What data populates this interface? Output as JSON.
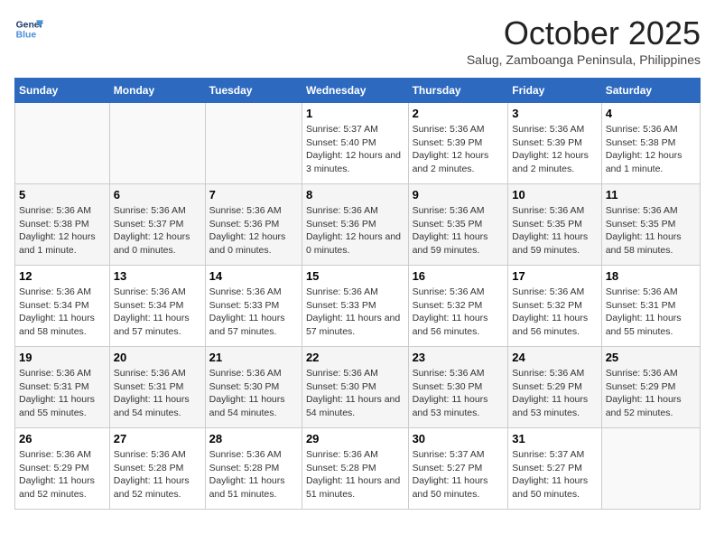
{
  "header": {
    "logo_line1": "General",
    "logo_line2": "Blue",
    "month": "October 2025",
    "location": "Salug, Zamboanga Peninsula, Philippines"
  },
  "weekdays": [
    "Sunday",
    "Monday",
    "Tuesday",
    "Wednesday",
    "Thursday",
    "Friday",
    "Saturday"
  ],
  "weeks": [
    [
      {
        "day": "",
        "info": ""
      },
      {
        "day": "",
        "info": ""
      },
      {
        "day": "",
        "info": ""
      },
      {
        "day": "1",
        "info": "Sunrise: 5:37 AM\nSunset: 5:40 PM\nDaylight: 12 hours and 3 minutes."
      },
      {
        "day": "2",
        "info": "Sunrise: 5:36 AM\nSunset: 5:39 PM\nDaylight: 12 hours and 2 minutes."
      },
      {
        "day": "3",
        "info": "Sunrise: 5:36 AM\nSunset: 5:39 PM\nDaylight: 12 hours and 2 minutes."
      },
      {
        "day": "4",
        "info": "Sunrise: 5:36 AM\nSunset: 5:38 PM\nDaylight: 12 hours and 1 minute."
      }
    ],
    [
      {
        "day": "5",
        "info": "Sunrise: 5:36 AM\nSunset: 5:38 PM\nDaylight: 12 hours and 1 minute."
      },
      {
        "day": "6",
        "info": "Sunrise: 5:36 AM\nSunset: 5:37 PM\nDaylight: 12 hours and 0 minutes."
      },
      {
        "day": "7",
        "info": "Sunrise: 5:36 AM\nSunset: 5:36 PM\nDaylight: 12 hours and 0 minutes."
      },
      {
        "day": "8",
        "info": "Sunrise: 5:36 AM\nSunset: 5:36 PM\nDaylight: 12 hours and 0 minutes."
      },
      {
        "day": "9",
        "info": "Sunrise: 5:36 AM\nSunset: 5:35 PM\nDaylight: 11 hours and 59 minutes."
      },
      {
        "day": "10",
        "info": "Sunrise: 5:36 AM\nSunset: 5:35 PM\nDaylight: 11 hours and 59 minutes."
      },
      {
        "day": "11",
        "info": "Sunrise: 5:36 AM\nSunset: 5:35 PM\nDaylight: 11 hours and 58 minutes."
      }
    ],
    [
      {
        "day": "12",
        "info": "Sunrise: 5:36 AM\nSunset: 5:34 PM\nDaylight: 11 hours and 58 minutes."
      },
      {
        "day": "13",
        "info": "Sunrise: 5:36 AM\nSunset: 5:34 PM\nDaylight: 11 hours and 57 minutes."
      },
      {
        "day": "14",
        "info": "Sunrise: 5:36 AM\nSunset: 5:33 PM\nDaylight: 11 hours and 57 minutes."
      },
      {
        "day": "15",
        "info": "Sunrise: 5:36 AM\nSunset: 5:33 PM\nDaylight: 11 hours and 57 minutes."
      },
      {
        "day": "16",
        "info": "Sunrise: 5:36 AM\nSunset: 5:32 PM\nDaylight: 11 hours and 56 minutes."
      },
      {
        "day": "17",
        "info": "Sunrise: 5:36 AM\nSunset: 5:32 PM\nDaylight: 11 hours and 56 minutes."
      },
      {
        "day": "18",
        "info": "Sunrise: 5:36 AM\nSunset: 5:31 PM\nDaylight: 11 hours and 55 minutes."
      }
    ],
    [
      {
        "day": "19",
        "info": "Sunrise: 5:36 AM\nSunset: 5:31 PM\nDaylight: 11 hours and 55 minutes."
      },
      {
        "day": "20",
        "info": "Sunrise: 5:36 AM\nSunset: 5:31 PM\nDaylight: 11 hours and 54 minutes."
      },
      {
        "day": "21",
        "info": "Sunrise: 5:36 AM\nSunset: 5:30 PM\nDaylight: 11 hours and 54 minutes."
      },
      {
        "day": "22",
        "info": "Sunrise: 5:36 AM\nSunset: 5:30 PM\nDaylight: 11 hours and 54 minutes."
      },
      {
        "day": "23",
        "info": "Sunrise: 5:36 AM\nSunset: 5:30 PM\nDaylight: 11 hours and 53 minutes."
      },
      {
        "day": "24",
        "info": "Sunrise: 5:36 AM\nSunset: 5:29 PM\nDaylight: 11 hours and 53 minutes."
      },
      {
        "day": "25",
        "info": "Sunrise: 5:36 AM\nSunset: 5:29 PM\nDaylight: 11 hours and 52 minutes."
      }
    ],
    [
      {
        "day": "26",
        "info": "Sunrise: 5:36 AM\nSunset: 5:29 PM\nDaylight: 11 hours and 52 minutes."
      },
      {
        "day": "27",
        "info": "Sunrise: 5:36 AM\nSunset: 5:28 PM\nDaylight: 11 hours and 52 minutes."
      },
      {
        "day": "28",
        "info": "Sunrise: 5:36 AM\nSunset: 5:28 PM\nDaylight: 11 hours and 51 minutes."
      },
      {
        "day": "29",
        "info": "Sunrise: 5:36 AM\nSunset: 5:28 PM\nDaylight: 11 hours and 51 minutes."
      },
      {
        "day": "30",
        "info": "Sunrise: 5:37 AM\nSunset: 5:27 PM\nDaylight: 11 hours and 50 minutes."
      },
      {
        "day": "31",
        "info": "Sunrise: 5:37 AM\nSunset: 5:27 PM\nDaylight: 11 hours and 50 minutes."
      },
      {
        "day": "",
        "info": ""
      }
    ]
  ]
}
